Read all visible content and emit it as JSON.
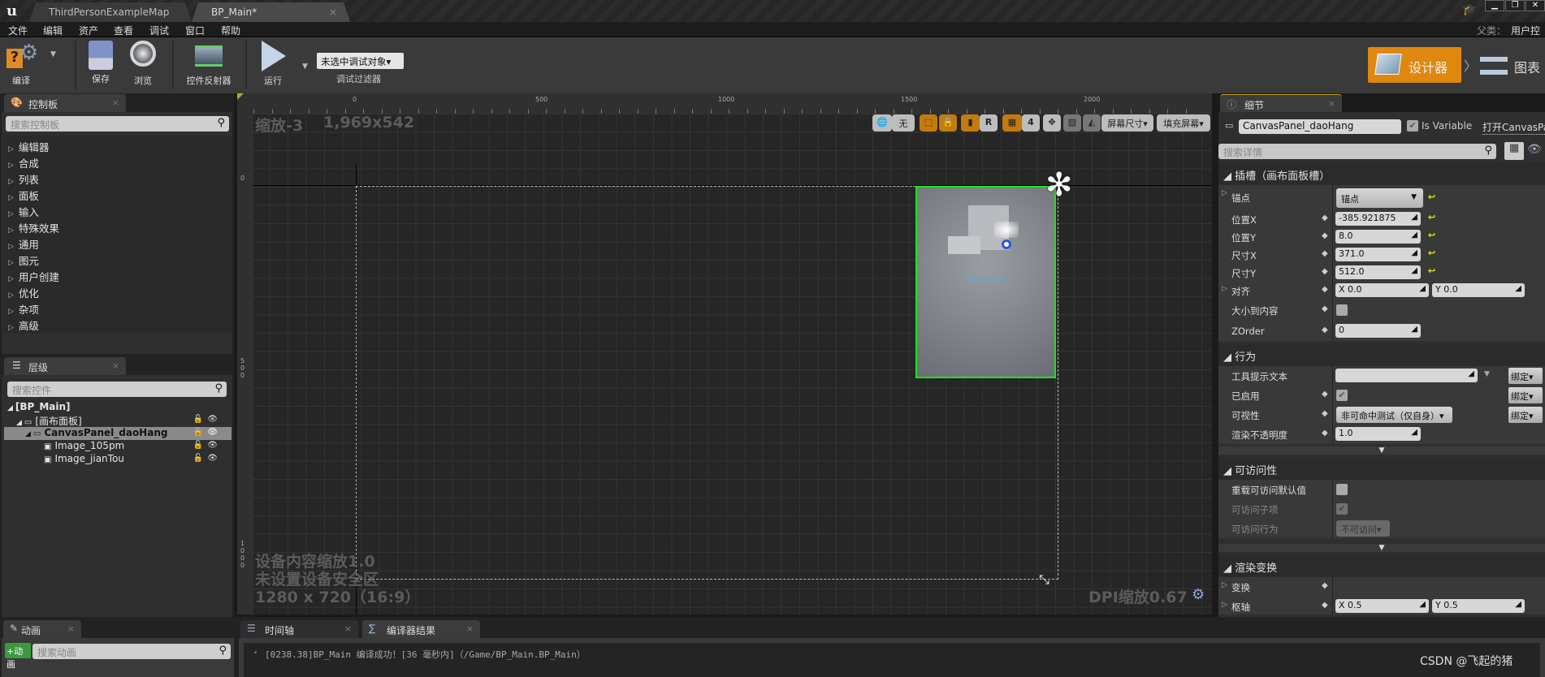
{
  "window": {
    "tabs": [
      {
        "label": "ThirdPersonExampleMap"
      },
      {
        "label": "BP_Main*"
      }
    ],
    "parent_class_label": "父类：",
    "parent_class_value": "用户控件"
  },
  "menu": [
    "文件",
    "编辑",
    "资产",
    "查看",
    "调试",
    "窗口",
    "帮助"
  ],
  "toolbar": {
    "compile": "编译",
    "save": "保存",
    "browse": "浏览",
    "widget_reflector": "控件反射器",
    "run": "运行",
    "debug_dropdown": "未选中调试对象▾",
    "debug_filter": "调试过滤器",
    "designer": "设计器",
    "graph": "图表"
  },
  "palette": {
    "tab": "控制板",
    "search_placeholder": "搜索控制板",
    "items": [
      "编辑器",
      "合成",
      "列表",
      "面板",
      "输入",
      "特殊效果",
      "通用",
      "图元",
      "用户创建",
      "优化",
      "杂项",
      "高级"
    ]
  },
  "hierarchy": {
    "tab": "层级",
    "search_placeholder": "搜索控件",
    "items": [
      {
        "label": "[BP_Main]",
        "level": 0
      },
      {
        "label": "[画布面板]",
        "level": 1
      },
      {
        "label": "CanvasPanel_daoHang",
        "level": 2,
        "selected": true
      },
      {
        "label": "Image_105pm",
        "level": 3
      },
      {
        "label": "Image_jianTou",
        "level": 3
      }
    ]
  },
  "viewport": {
    "zoom": "缩放-3",
    "resolution": "1,969x542",
    "ruler_h": [
      "0",
      "500",
      "1000",
      "1500",
      "2000"
    ],
    "ruler_v": [
      "0",
      "500",
      "1000"
    ],
    "toolbar": {
      "world": "无",
      "r": "R",
      "grid": "4",
      "screen_size": "屏幕尺寸▾",
      "fill_screen": "填充屏幕▾"
    },
    "info": [
      "设备内容缩放1.0",
      "未设置设备安全区",
      "1280 x 720（16:9）"
    ],
    "dpi": "DPI缩放0.67",
    "widget_text": "Third Person",
    "accent": "#19e619"
  },
  "details": {
    "tab": "细节",
    "name": "CanvasPanel_daoHang",
    "is_variable_label": "Is Variable",
    "is_variable": true,
    "open_link": "打开CanvasPanel",
    "search_placeholder": "搜索详情",
    "slot": {
      "header": "插槽（画布面板槽）",
      "anchor_label": "锚点",
      "anchor_value": "锚点",
      "pos_x_label": "位置X",
      "pos_x": "-385.921875",
      "pos_y_label": "位置Y",
      "pos_y": "8.0",
      "size_x_label": "尺寸X",
      "size_x": "371.0",
      "size_y_label": "尺寸Y",
      "size_y": "512.0",
      "align_label": "对齐",
      "align_x": "X  0.0",
      "align_y": "Y  0.0",
      "size_to_content_label": "大小到内容",
      "size_to_content": false,
      "zorder_label": "ZOrder",
      "zorder": "0"
    },
    "behavior": {
      "header": "行为",
      "tooltip_label": "工具提示文本",
      "tooltip": "",
      "enabled_label": "已启用",
      "enabled": true,
      "visibility_label": "可视性",
      "visibility": "非可命中测试（仅自身）▾",
      "opacity_label": "渲染不透明度",
      "opacity": "1.0",
      "bind": "绑定▾"
    },
    "accessibility": {
      "header": "可访问性",
      "override_label": "重载可访问默认值",
      "children_label": "可访问子项",
      "behavior_label": "可访问行为",
      "behavior_value": "不可访问▾"
    },
    "render_transform": {
      "header": "渲染变换",
      "transform_label": "变换",
      "pivot_label": "枢轴",
      "pivot_x": "X  0.5",
      "pivot_y": "Y  0.5"
    }
  },
  "animation": {
    "tab": "动画",
    "add": "+动画",
    "search_placeholder": "搜索动画"
  },
  "bottom_tabs": [
    {
      "label": "时间轴"
    },
    {
      "label": "编译器结果"
    }
  ],
  "log": [
    "[0238.38]BP_Main 编译成功！[36 毫秒内]（/Game/BP_Main.BP_Main）"
  ],
  "watermark": "CSDN @飞起的猪"
}
